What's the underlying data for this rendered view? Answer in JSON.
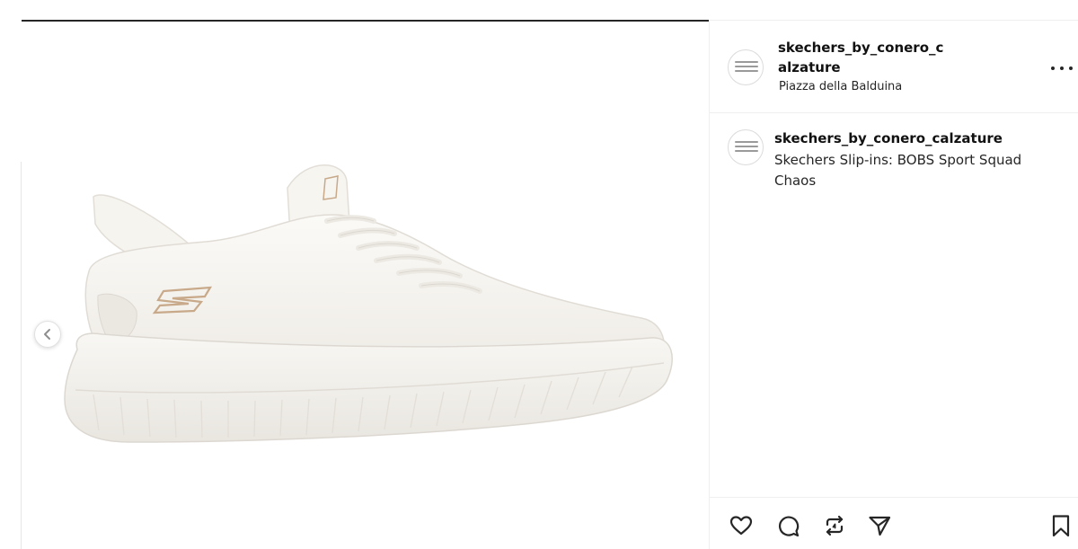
{
  "post": {
    "image_alt": "Skechers Slip-ins: BOBS Sport Squad Chaos",
    "header": {
      "username": "skechers_by_conero_calzature",
      "location": "Piazza della Balduina"
    },
    "caption": {
      "username": "skechers_by_conero_calzature",
      "text": "Skechers Slip-ins: BOBS Sport Squad Chaos"
    },
    "actions": {
      "like_icon": "heart-icon",
      "comment_icon": "comment-icon",
      "repost_icon": "repost-icon",
      "share_icon": "share-icon",
      "save_icon": "bookmark-icon"
    },
    "colors": {
      "text": "#262626",
      "border": "#efefef",
      "shoe": "#f5f3ee",
      "logo_accent": "#c8a98a"
    }
  }
}
